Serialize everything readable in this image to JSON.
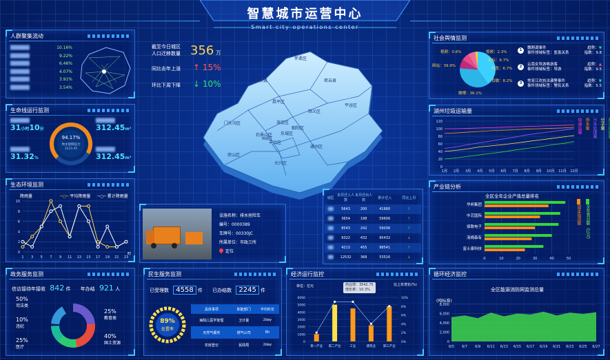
{
  "header": {
    "title": "智慧城市运营中心",
    "subtitle": "Smart city operations center"
  },
  "crowd": {
    "title": "人群聚集流动",
    "rows": [
      {
        "name": "██████",
        "value": "10.16%"
      },
      {
        "name": "██████",
        "value": "9.22%"
      },
      {
        "name": "██████",
        "value": "6.46%"
      },
      {
        "name": "██████",
        "value": "4.07%"
      },
      {
        "name": "██████",
        "value": "3.91%"
      },
      {
        "name": "██████",
        "value": "3.54%"
      }
    ]
  },
  "lifeline": {
    "title": "生命线运行监测",
    "items": [
      {
        "value": "31",
        "unit": "小时",
        "extra": "10",
        "extra_unit": "分",
        "label": "██████"
      },
      {
        "value": "312.45",
        "unit": "m³",
        "label": "██████"
      },
      {
        "value": "31.32",
        "unit": "%",
        "label": "██████"
      },
      {
        "value": "312.45",
        "unit": "m³",
        "label": "██████"
      }
    ],
    "gauge": {
      "value": "94.17%",
      "label": "供水管网压力",
      "sub": "3123.45",
      "fraction": 0.94
    }
  },
  "eco": {
    "title": "生态环境监测",
    "ylabel": "降雨量",
    "legend": [
      "平均降雨量",
      "累计降雨量"
    ],
    "xunit": "时"
  },
  "gov": {
    "title": "政务服务监测",
    "received_label": "信访接待年接收",
    "received": "842",
    "received_unit": "件",
    "done_label": "年办结",
    "done": "921",
    "done_unit": "人",
    "segments": [
      {
        "pct": "50%",
        "label": "司法类"
      },
      {
        "pct": "10%",
        "label": "违纪"
      },
      {
        "pct": "25%",
        "label": "医疗"
      },
      {
        "pct": "25%",
        "label": "教育类"
      },
      {
        "pct": "40%",
        "label": "国土资源"
      }
    ]
  },
  "kpi": {
    "today_label1": "截至今日城区",
    "today_label2": "人口迁移数量",
    "today_value": "356",
    "today_unit": "万",
    "yoy_label": "同比去年上涨",
    "yoy_value": "15%",
    "mom_label": "环比下周下降",
    "mom_value": "10%"
  },
  "map": {
    "districts": [
      "怀柔区",
      "延庆县",
      "密云县",
      "昌平区",
      "平谷区",
      "顺义区",
      "门头沟区",
      "海淀区",
      "朝阳区",
      "石景山区",
      "东城区",
      "西城区",
      "丰台区",
      "通州区",
      "房山区",
      "大兴区"
    ]
  },
  "vehicle": {
    "device_label": "设施名称：",
    "device": "排水抢险车",
    "code_label": "编号：",
    "code": "0000389",
    "plate_label": "车牌号：",
    "plate": "00330JC",
    "unit_label": "所属单位：",
    "unit": "市政三所",
    "locate": "定位"
  },
  "migration": {
    "headers": [
      "城区",
      "本月迁入人数",
      "本月迁出人数",
      "累计迁入",
      "同比上月"
    ],
    "rows": [
      [
        "██",
        "5643",
        "200",
        "41680",
        "↑"
      ],
      [
        "██",
        "3654",
        "198",
        "59606",
        "↑"
      ],
      [
        "██",
        "8543",
        "242",
        "59036",
        "↑"
      ],
      [
        "██",
        "9322",
        "432",
        "95432",
        "↓"
      ],
      [
        "██",
        "4213",
        "455",
        "98541",
        "↑"
      ],
      [
        "██",
        "12532",
        "368",
        "53516",
        "↓"
      ]
    ]
  },
  "livelihood": {
    "title": "民生服务监测",
    "processed_label": "已受理数",
    "processed": "4558",
    "processed_unit": "件",
    "closed_label": "已办结数",
    "closed": "2245",
    "closed_unit": "件",
    "gauge_value": "89%",
    "gauge_label": "处置率",
    "headers": [
      "具体事项",
      "职能部门",
      "平均时长"
    ],
    "rows": [
      [
        "病院儿医学复理",
        "卫计委",
        "2day"
      ],
      [
        "天然气服务",
        "燃气公司",
        "8h"
      ],
      [
        "农房登记",
        "民政局",
        "2day"
      ]
    ]
  },
  "economy": {
    "title": "经济运行监控",
    "ylabel": "单位：亿元",
    "y2label": "比上年增长(%)",
    "tooltip1": "商业增：3542.75",
    "tooltip2": "增长率：10.3%",
    "chart_data": {
      "type": "bar",
      "categories": [
        "第一产业",
        "第二产业",
        "工业",
        "建筑业",
        "第三产业"
      ],
      "series": [
        {
          "values": [
            1000,
            5000,
            4500,
            2200,
            4800
          ]
        }
      ],
      "ylim": [
        0,
        6000
      ],
      "y2": [
        2,
        9,
        9,
        4,
        8
      ],
      "y2lim": [
        0,
        10
      ]
    }
  },
  "opinion": {
    "title": "社会舆情监测",
    "slices": [
      {
        "label": "视频：",
        "value": "2.3%"
      },
      {
        "label": "论坛：",
        "value": "6.7%"
      },
      {
        "label": "问答：",
        "value": "6.7%"
      },
      {
        "label": "百微：",
        "value": "8.2%"
      },
      {
        "label": "微博：",
        "value": "36.1%"
      },
      {
        "label": "网站：",
        "value": "39.9%"
      },
      {
        "label": "视频：",
        "value": "0.6%"
      }
    ],
    "events": [
      {
        "num": "1",
        "title": "魏刚调事件",
        "field": "事件领域标签：医患关系",
        "trend": "趋势：",
        "score": "指数：9.8"
      },
      {
        "num": "2",
        "title": "云南女导游辱游客",
        "field": "事件领域标签：导游",
        "trend": "趋势：",
        "score": "指数：9.5"
      },
      {
        "num": "3",
        "title": "常宠江欢执法袭警事件",
        "field": "事件领域标签：警民关系",
        "trend": "趋势：",
        "score": "指数：5.5"
      }
    ]
  },
  "waste": {
    "title": "湖州垃圾运输量",
    "chart_data": {
      "type": "line",
      "categories": [
        "1月",
        "2月",
        "3月",
        "4月",
        "5月",
        "6月",
        "7月",
        "8月",
        "9月",
        "10月",
        "11月",
        "12月"
      ],
      "ylim": [
        0,
        120
      ],
      "series": [
        {
          "name": "快递运输",
          "values": [
            100,
            100,
            101,
            102,
            103,
            104,
            105,
            106,
            107,
            108,
            109,
            110
          ]
        },
        {
          "name": "用水量",
          "values": [
            88,
            89,
            91,
            93,
            95,
            96,
            97,
            99,
            100,
            101,
            102,
            104
          ]
        },
        {
          "name": "污水处理量",
          "values": [
            48,
            52,
            58,
            63,
            68,
            73,
            78,
            84,
            88,
            92,
            96,
            100
          ]
        },
        {
          "name": "分子量",
          "values": [
            40,
            43,
            47,
            52,
            55,
            58,
            62,
            66,
            70,
            74,
            78,
            82
          ]
        },
        {
          "name": "废水排放量",
          "values": [
            20,
            23,
            27,
            31,
            35,
            39,
            44,
            48,
            52,
            57,
            61,
            66
          ]
        }
      ]
    }
  },
  "industry": {
    "title": "产业链分析",
    "chart_title": "全区全年企业产值总量排名",
    "legend": [
      "固定投资额",
      "全年营业额（亿元）"
    ],
    "chart_data": {
      "type": "bar",
      "categories": [
        "华邦集团",
        "中芯国际",
        "探聪电子",
        "汤姆森有",
        "富士康科技"
      ],
      "ylim": [
        0,
        50
      ],
      "series": [
        {
          "name": "固定投资额",
          "values": [
            38,
            33,
            30,
            28,
            24
          ]
        },
        {
          "name": "全年营业额（亿元）",
          "values": [
            48,
            45,
            44,
            40,
            35
          ]
        }
      ]
    }
  },
  "circular": {
    "title": "循环经济监控",
    "chart_title": "全区能源消防网监测总量",
    "ylabel": "(吨标准)",
    "chart_data": {
      "type": "area",
      "categories": [
        "6/5",
        "6/7",
        "6/9",
        "6/11",
        "6/13",
        "6/15",
        "6/17",
        "6/19",
        "6/21",
        "6/23",
        "6/25",
        "6/27"
      ],
      "ylim": [
        0,
        8000
      ],
      "values": [
        5200,
        5600,
        5000,
        6200,
        5400,
        6000,
        5800,
        6400,
        5600,
        6200,
        5900,
        6300
      ]
    }
  }
}
